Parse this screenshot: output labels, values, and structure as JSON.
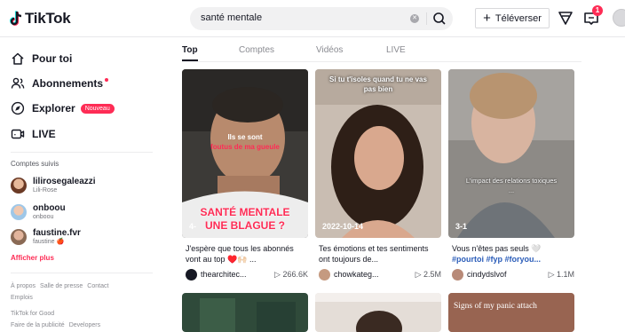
{
  "header": {
    "logo_text": "TikTok",
    "search_value": "santé mentale",
    "upload_label": "Téléverser",
    "upload_icon": "plus-icon",
    "inbox_badge": "1"
  },
  "sidebar": {
    "nav": [
      {
        "label": "Pour toi",
        "icon": "home-icon"
      },
      {
        "label": "Abonnements",
        "icon": "users-icon"
      },
      {
        "label": "Explorer",
        "icon": "compass-icon",
        "badge": "Nouveau"
      },
      {
        "label": "LIVE",
        "icon": "live-icon"
      }
    ],
    "following_heading": "Comptes suivis",
    "accounts": [
      {
        "name": "lilirosegaleazzi",
        "sub": "Lili-Rose"
      },
      {
        "name": "onboou",
        "sub": "onboou"
      },
      {
        "name": "faustine.fvr",
        "sub": "faustine 🍎"
      }
    ],
    "show_more": "Afficher plus",
    "footer": [
      [
        "À propos",
        "Salle de presse",
        "Contact"
      ],
      [
        "Emplois"
      ],
      [
        "TikTok for Good"
      ],
      [
        "Faire de la publicité",
        "Developers"
      ]
    ]
  },
  "tabs": [
    "Top",
    "Comptes",
    "Vidéos",
    "LIVE"
  ],
  "videos": [
    {
      "overlay_top": "Ils se sont",
      "overlay_mid": "foutus de ma gueule",
      "overlay_big1": "SANTÉ MENTALE",
      "overlay_big2": "UNE BLAGUE ?",
      "corner": "4-",
      "caption": "J'espère que tous les abonnés vont au top ♥️🙌🏻 ...",
      "author": "thearchitec...",
      "views": "266.6K"
    },
    {
      "overlay_top": "Si tu t'isoles quand tu ne vas pas bien",
      "corner": "2022-10-14",
      "caption": "Tes émotions et tes sentiments ont toujours de...",
      "author": "chowkateg...",
      "views": "2.5M"
    },
    {
      "overlay_mid": "L'impact des relations toxiques ...",
      "corner": "3-1",
      "caption_text": "Vous n'êtes pas seuls 🤍",
      "caption_tags": "#pourtoi #fyp #foryou...",
      "author": "cindydslvof",
      "views": "1.1M"
    }
  ],
  "second_row": {
    "overlay_text": "Signs of my panic attach"
  },
  "colors": {
    "accent": "#fe2c55",
    "tag_blue": "#2b5db9"
  }
}
